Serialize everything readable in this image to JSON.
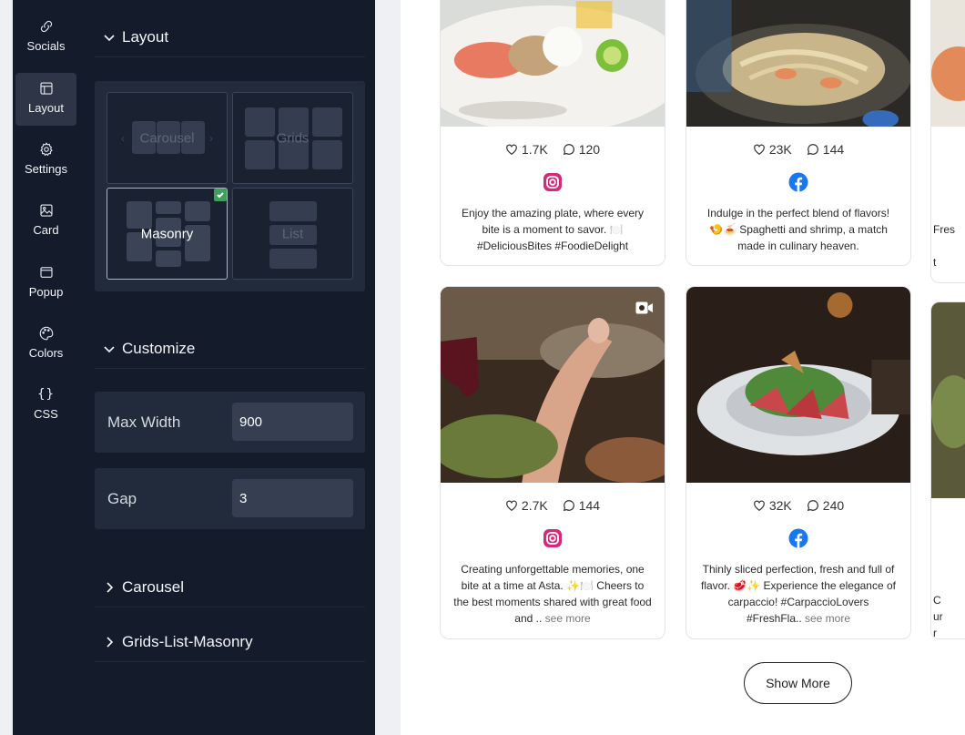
{
  "sidebar": {
    "items": [
      {
        "label": "Socials",
        "icon": "link-icon"
      },
      {
        "label": "Layout",
        "icon": "layout-icon",
        "active": true
      },
      {
        "label": "Settings",
        "icon": "gear-icon"
      },
      {
        "label": "Card",
        "icon": "image-card-icon"
      },
      {
        "label": "Popup",
        "icon": "popup-window-icon"
      },
      {
        "label": "Colors",
        "icon": "palette-icon"
      },
      {
        "label": "CSS",
        "icon": "css-braces-icon",
        "glyph": "{}"
      }
    ]
  },
  "settings": {
    "layout": {
      "title": "Layout",
      "options": [
        {
          "label": "Carousel",
          "selected": false
        },
        {
          "label": "Grids",
          "selected": false
        },
        {
          "label": "Masonry",
          "selected": true
        },
        {
          "label": "List",
          "selected": false
        }
      ],
      "carousel_prev": "‹",
      "carousel_next": "›"
    },
    "customize": {
      "title": "Customize",
      "fields": [
        {
          "label": "Max Width",
          "value": "900"
        },
        {
          "label": "Gap",
          "value": "3"
        }
      ]
    },
    "collapsed_sections": [
      {
        "title": "Carousel"
      },
      {
        "title": "Grids-List-Masonry"
      }
    ]
  },
  "feed": {
    "posts": [
      {
        "likes": "1.7K",
        "comments": "120",
        "platform": "instagram",
        "caption": "Enjoy the amazing plate, where every bite is a moment to savor. 🍽️ #DeliciousBites #FoodieDelight",
        "see_more": ""
      },
      {
        "likes": "23K",
        "comments": "144",
        "platform": "facebook",
        "caption": "Indulge in the perfect blend of flavors! 🍤🍝 Spaghetti and shrimp, a match made in culinary heaven.",
        "see_more": ""
      },
      {
        "likes": "",
        "comments": "",
        "platform": "",
        "caption": "Fres\n\nt",
        "see_more": ""
      },
      {
        "likes": "2.7K",
        "comments": "144",
        "platform": "instagram",
        "caption": "Creating unforgettable memories, one bite at a time at Asta. ✨🍽️ Cheers to the best moments shared with great food and ..",
        "see_more": "see more"
      },
      {
        "likes": "32K",
        "comments": "240",
        "platform": "facebook",
        "caption": "Thinly sliced perfection, fresh and full of flavor. 🥩✨ Experience the elegance of carpaccio! #CarpaccioLovers #FreshFla..",
        "see_more": "see more"
      },
      {
        "likes": "",
        "comments": "",
        "platform": "",
        "caption": "C\nur\nr",
        "see_more": ""
      }
    ],
    "show_more_label": "Show More"
  },
  "colors": {
    "panel_bg": "#141c2b",
    "panel_active": "#2d3546",
    "selected_check": "#3ea05a",
    "instagram": "#d62976",
    "facebook": "#1877f2"
  }
}
